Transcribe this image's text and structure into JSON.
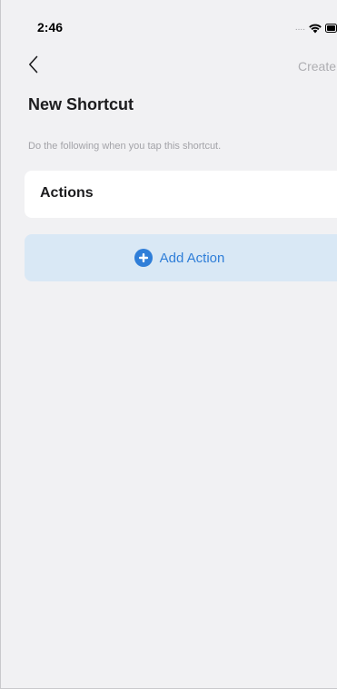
{
  "status_bar": {
    "time": "2:46",
    "signal": "....",
    "icons": [
      "wifi-icon",
      "battery-icon"
    ]
  },
  "nav": {
    "back_icon": "chevron-left-icon",
    "create_label": "Create"
  },
  "page": {
    "title": "New Shortcut",
    "subtitle": "Do the following when you tap this shortcut."
  },
  "actions": {
    "header": "Actions",
    "add_label": "Add Action",
    "add_icon": "plus-circle-icon"
  },
  "colors": {
    "background": "#f1f1f3",
    "card": "#ffffff",
    "accent": "#2f7ed8",
    "add_button_bg": "#d9e8f5",
    "disabled_text": "#aeaeb2"
  }
}
